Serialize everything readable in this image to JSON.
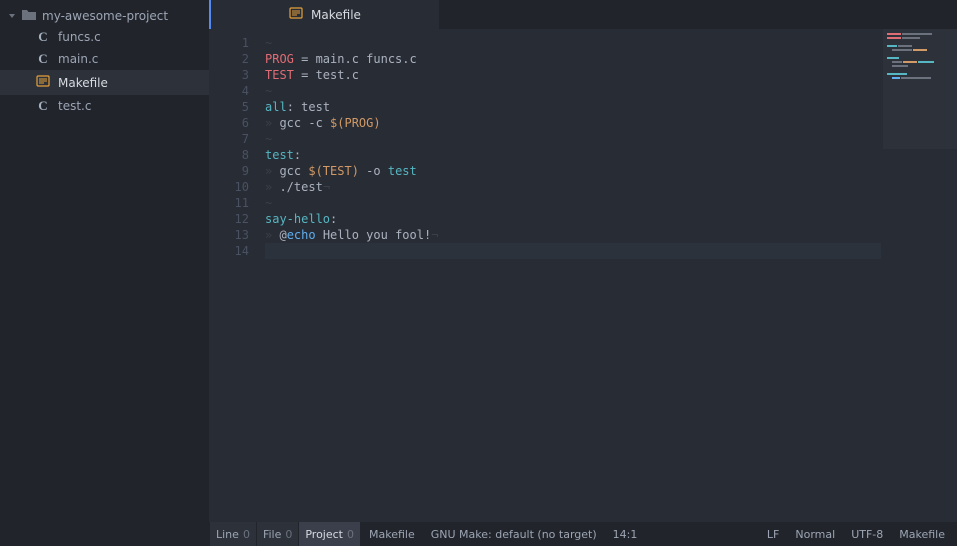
{
  "sidebar": {
    "project_name": "my-awesome-project",
    "files": [
      {
        "name": "funcs.c",
        "icon": "c",
        "selected": false
      },
      {
        "name": "main.c",
        "icon": "c",
        "selected": false
      },
      {
        "name": "Makefile",
        "icon": "mk",
        "selected": true
      },
      {
        "name": "test.c",
        "icon": "c",
        "selected": false
      }
    ]
  },
  "tab": {
    "label": "Makefile"
  },
  "editor": {
    "line_count": 14,
    "cursor_line": 14,
    "lines": [
      [
        {
          "cls": "ws",
          "t": "~"
        }
      ],
      [
        {
          "cls": "kw-red",
          "t": "PROG"
        },
        {
          "cls": "plain",
          "t": " = main.c funcs.c"
        }
      ],
      [
        {
          "cls": "kw-red",
          "t": "TEST"
        },
        {
          "cls": "plain",
          "t": " = test.c"
        }
      ],
      [
        {
          "cls": "ws",
          "t": "~"
        }
      ],
      [
        {
          "cls": "kw-teal",
          "t": "all"
        },
        {
          "cls": "punct",
          "t": ": "
        },
        {
          "cls": "plain",
          "t": "test"
        }
      ],
      [
        {
          "cls": "ws",
          "t": "» "
        },
        {
          "cls": "plain",
          "t": "gcc -c "
        },
        {
          "cls": "var-orange",
          "t": "$(PROG)"
        }
      ],
      [
        {
          "cls": "ws",
          "t": "~"
        }
      ],
      [
        {
          "cls": "kw-teal",
          "t": "test"
        },
        {
          "cls": "punct",
          "t": ":"
        }
      ],
      [
        {
          "cls": "ws",
          "t": "» "
        },
        {
          "cls": "plain",
          "t": "gcc "
        },
        {
          "cls": "var-orange",
          "t": "$(TEST)"
        },
        {
          "cls": "plain",
          "t": " -o "
        },
        {
          "cls": "kw-teal",
          "t": "test"
        }
      ],
      [
        {
          "cls": "ws",
          "t": "» "
        },
        {
          "cls": "plain",
          "t": "./test"
        },
        {
          "cls": "ws",
          "t": "¬"
        }
      ],
      [
        {
          "cls": "ws",
          "t": "~"
        }
      ],
      [
        {
          "cls": "kw-teal",
          "t": "say-hello"
        },
        {
          "cls": "punct",
          "t": ":"
        }
      ],
      [
        {
          "cls": "ws",
          "t": "» "
        },
        {
          "cls": "plain",
          "t": "@"
        },
        {
          "cls": "kw-cyan",
          "t": "echo"
        },
        {
          "cls": "plain",
          "t": " Hello you fool!"
        },
        {
          "cls": "ws",
          "t": "¬"
        }
      ],
      []
    ]
  },
  "status": {
    "left": [
      {
        "label": "Line",
        "count": "0",
        "lit": false
      },
      {
        "label": "File",
        "count": "0",
        "lit": false
      },
      {
        "label": "Project",
        "count": "0",
        "lit": true
      }
    ],
    "filename": "Makefile",
    "syntax": "GNU Make: default (no target)",
    "position": "14:1",
    "right": {
      "line_ending": "LF",
      "mode": "Normal",
      "encoding": "UTF-8",
      "grammar": "Makefile"
    }
  }
}
